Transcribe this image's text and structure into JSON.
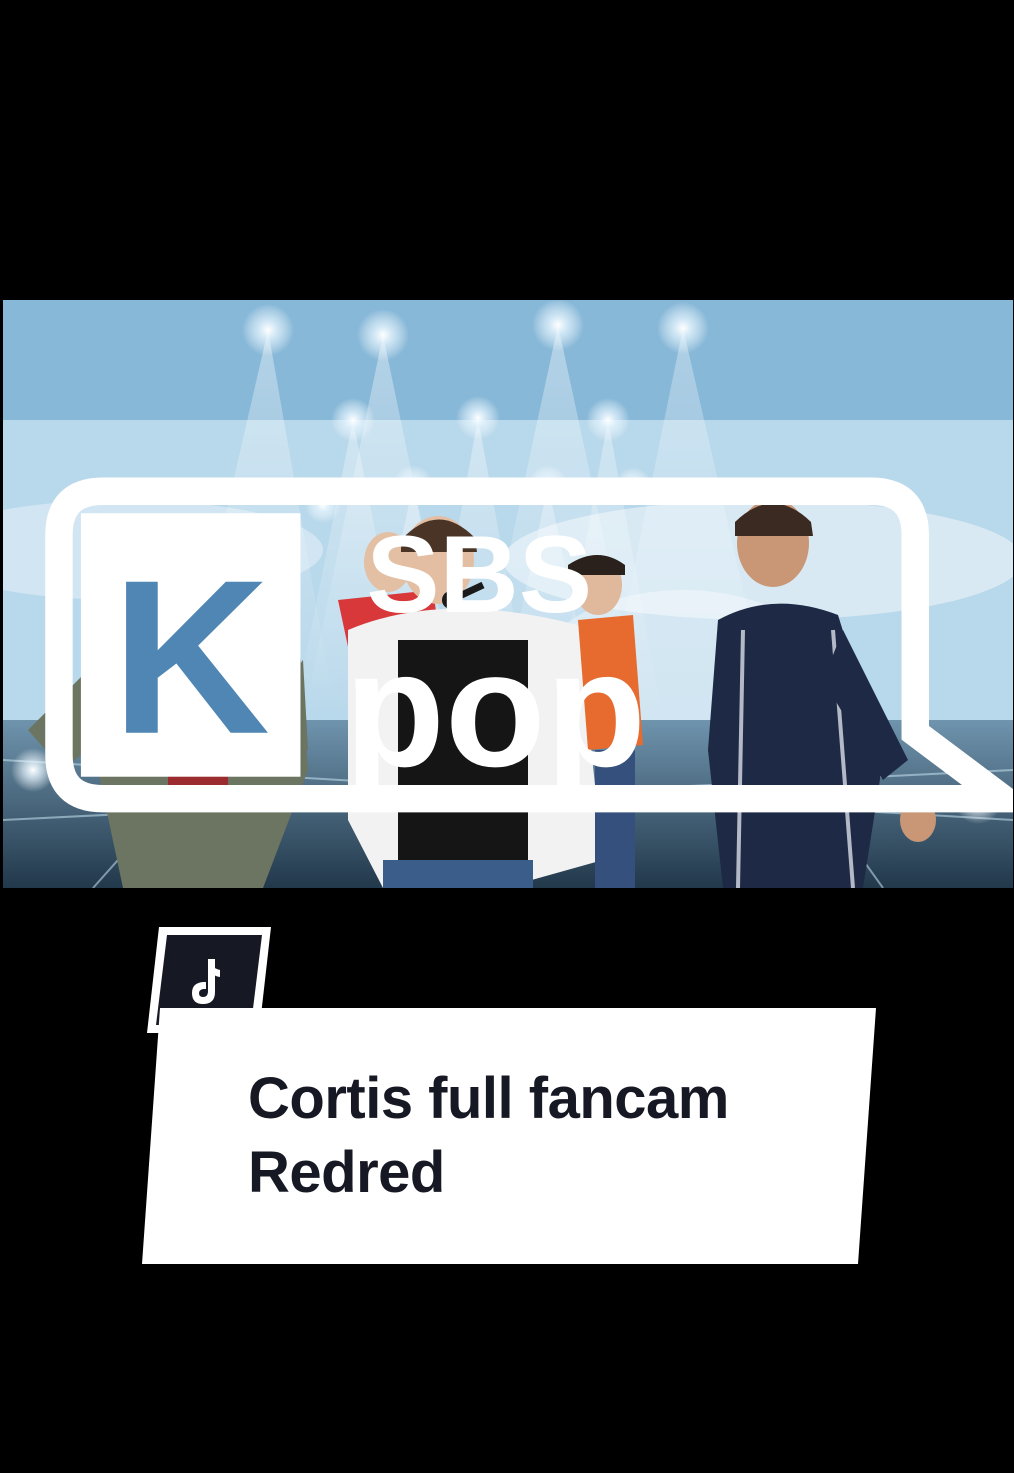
{
  "video": {
    "broadcaster_logo": {
      "line1": "SBS",
      "line2": "pop",
      "mark": "K"
    },
    "scene": "stage-performance-still"
  },
  "badge": {
    "icon": "tiktok-logo-icon"
  },
  "caption": {
    "line1": "Cortis full fancam",
    "line2": "Redred"
  },
  "colors": {
    "background": "#000000",
    "caption_card": "#ffffff",
    "caption_text": "#161823",
    "badge_fill": "#161823"
  }
}
